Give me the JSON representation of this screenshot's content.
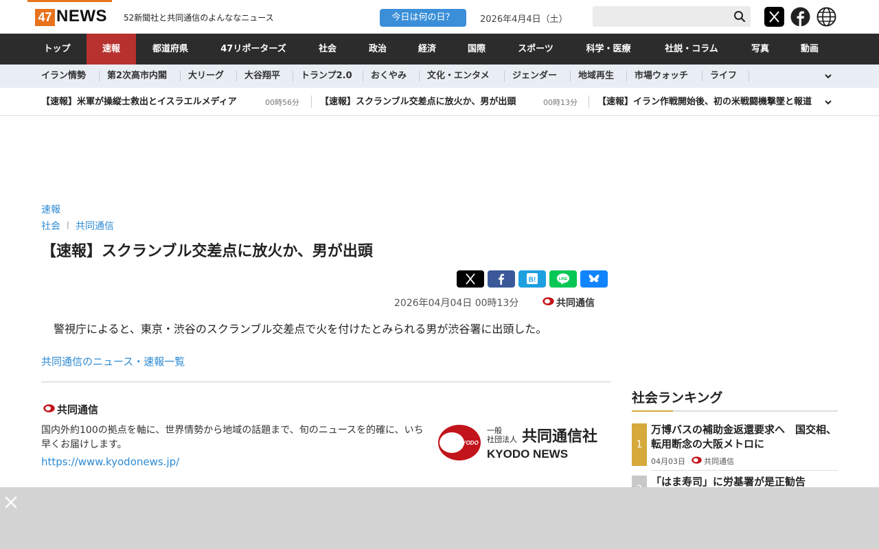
{
  "header": {
    "logo_number": "47",
    "logo_word": "NEWS",
    "tagline": "52新聞社と共同通信のよんななニュース",
    "today_button": "今日は何の日？",
    "date": "2026年4月4日（土）",
    "search_placeholder": ""
  },
  "main_nav": [
    "トップ",
    "速報",
    "都道府県",
    "47リポーターズ",
    "社会",
    "政治",
    "経済",
    "国際",
    "スポーツ",
    "科学・医療",
    "社説・コラム",
    "写真",
    "動画"
  ],
  "main_nav_active": "速報",
  "sub_nav": [
    "イラン情勢",
    "第2次高市内閣",
    "大リーグ",
    "大谷翔平",
    "トランプ2.0",
    "おくやみ",
    "文化・エンタメ",
    "ジェンダー",
    "地域再生",
    "市場ウォッチ",
    "ライフ"
  ],
  "ticker": [
    {
      "title": "【速報】米軍が操縦士救出とイスラエルメディア",
      "time": "00時56分"
    },
    {
      "title": "【速報】スクランブル交差点に放火か、男が出頭",
      "time": "00時13分"
    },
    {
      "title": "【速報】イラン作戦開始後、初の米戦闘機撃墜と報道",
      "time": ""
    }
  ],
  "article": {
    "category": "速報",
    "section": "社会",
    "source_crumb": "共同通信",
    "title": "【速報】スクランブル交差点に放火か、男が出頭",
    "datetime": "2026年04月04日  00時13分",
    "source": "共同通信",
    "body": "警視庁によると、東京・渋谷のスクランブル交差点で火を付けたとみられる男が渋谷署に出頭した。",
    "list_link": "共同通信のニュース・速報一覧"
  },
  "share_buttons": [
    {
      "name": "x",
      "color": "#000000"
    },
    {
      "name": "facebook",
      "color": "#3b5998"
    },
    {
      "name": "hatena",
      "color": "#1e9fe0"
    },
    {
      "name": "line",
      "color": "#06c755"
    },
    {
      "name": "bluesky",
      "color": "#1185fe"
    }
  ],
  "provider": {
    "name": "共同通信",
    "description": "国内外約100の拠点を軸に、世界情勢から地域の話題まで、旬のニュースを的確に、いち早くお届けします。",
    "url": "https://www.kyodonews.jp/",
    "logo_small": "一般\n社団法人",
    "logo_big": "共同通信社",
    "logo_en": "KYODO NEWS",
    "logo_circle": "KYODO"
  },
  "ranking": {
    "title": "社会ランキング",
    "items": [
      {
        "rank": "1",
        "title": "万博バスの補助金返還要求へ　国交相、転用断念の大阪メトロに",
        "date": "04月03日",
        "source": "共同通信"
      },
      {
        "rank": "2",
        "title": "「はま寿司」に労基署が是正勧告",
        "date": "",
        "source": ""
      }
    ]
  },
  "colors": {
    "brand_orange": "#e8731c",
    "nav_active_red": "#b7312e",
    "link_blue": "#2d8ad3",
    "rank_gold": "#d5a93b"
  }
}
